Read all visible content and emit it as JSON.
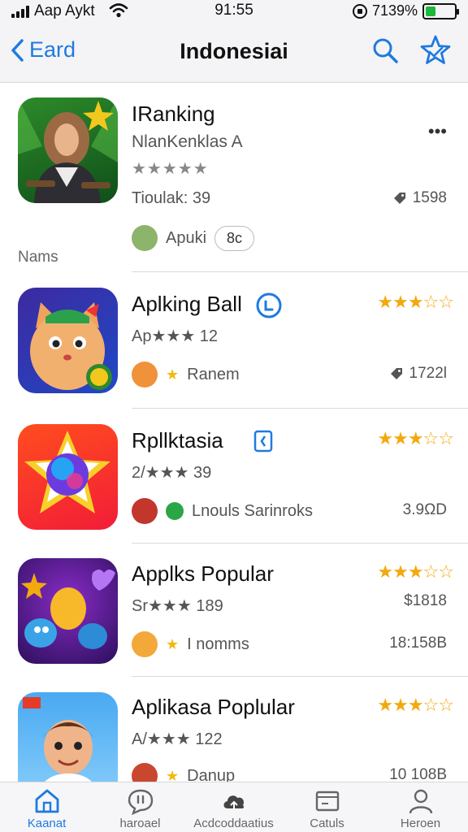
{
  "status_bar": {
    "carrier": "Aap Aykt",
    "time": "91:55",
    "battery": "7139%",
    "battery_level": 0.35
  },
  "nav": {
    "back_label": "Eard",
    "title": "Indonesiai"
  },
  "featured": {
    "name": "IRanking",
    "developer": "NlanKenklas A",
    "rating_text": "★★★★★",
    "downloads_label": "Tioulak: 39",
    "size": "1598",
    "chip_label": "Apuki",
    "chip_count": "8c",
    "section_label": "Nams",
    "more_label": "•••"
  },
  "apps": [
    {
      "name": "Aplking Ball",
      "rating_line": "Ap★★★ 12",
      "meta": "Ranem",
      "value": "1722l",
      "stars": "★★★☆☆"
    },
    {
      "name": "Rpllktasia",
      "rating_line": "2/★★★ 39",
      "meta": "Lnouls Sarinroks",
      "value": "3.9ΩD",
      "stars": "★★★☆☆"
    },
    {
      "name": "Applks Popular",
      "rating_line": "Sr★★★ 189",
      "meta": "I nomms",
      "value": "$1818",
      "size": "18:158B",
      "stars": "★★★☆☆"
    },
    {
      "name": "Aplikasa Poplular",
      "rating_line": "A/★★★ 122",
      "meta": "Danup",
      "value": "10 108B",
      "stars": "★★★☆☆"
    }
  ],
  "tabs": [
    {
      "label": "Kaanat",
      "icon": "home-icon"
    },
    {
      "label": "haroael",
      "icon": "chat-bubble-icon"
    },
    {
      "label": "Acdcoddaatius",
      "icon": "cloud-upload-icon"
    },
    {
      "label": "Catuls",
      "icon": "folder-icon"
    },
    {
      "label": "Heroen",
      "icon": "person-icon"
    }
  ],
  "colors": {
    "accent": "#1f7ae0",
    "star": "#f2a90f",
    "battery_fill": "#1bb83a"
  }
}
